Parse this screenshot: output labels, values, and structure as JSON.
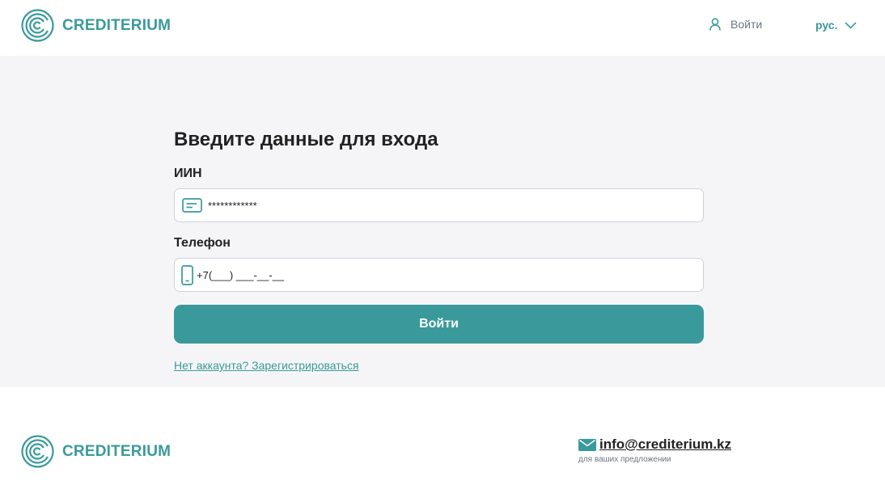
{
  "brand": {
    "name": "CREDITERIUM",
    "color": "#3a9a9b"
  },
  "header": {
    "login_label": "Войти",
    "language": "рус."
  },
  "form": {
    "title": "Введите данные для входа",
    "iin_label": "ИИН",
    "iin_value": "************",
    "phone_label": "Телефон",
    "phone_placeholder": "+7(___) ___-__-__",
    "submit_label": "Войти",
    "register_link": "Нет аккаунта? Зарегистрироваться"
  },
  "footer": {
    "email": "info@crediterium.kz",
    "email_note": "для ваших предложении"
  },
  "icons": {
    "logo": "crediterium-logo-icon",
    "user": "user-icon",
    "chevron": "chevron-down-icon",
    "id_card": "id-card-icon",
    "phone": "phone-icon",
    "mail": "mail-icon"
  }
}
